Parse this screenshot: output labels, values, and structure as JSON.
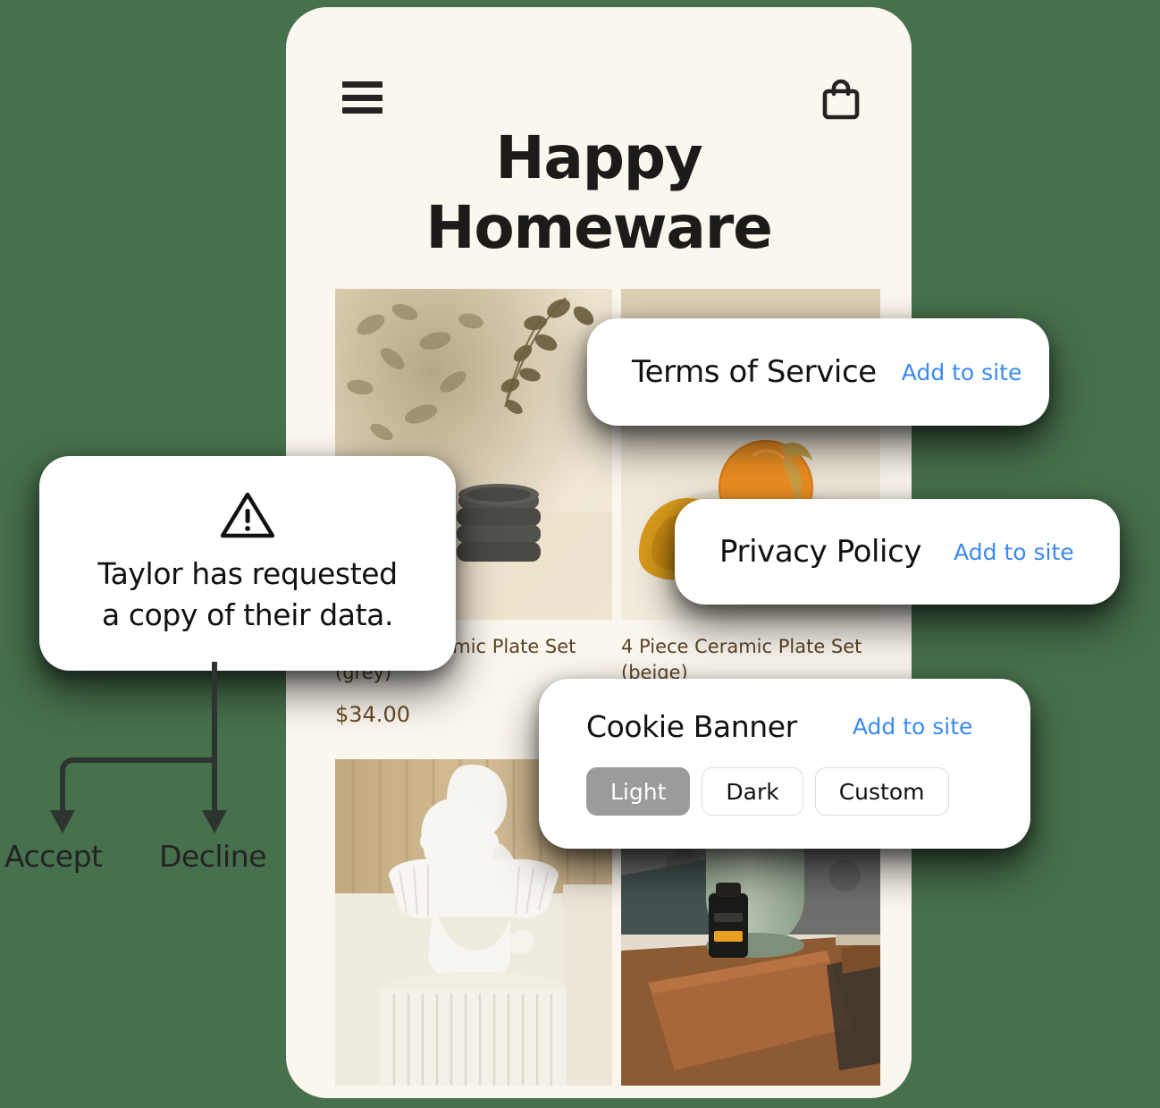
{
  "background_color": "#47704C",
  "phone": {
    "background_color": "#FBF6EE",
    "header": {
      "menu_icon": "hamburger-menu-icon",
      "cart_icon": "shopping-bag-icon",
      "brand_title": "Happy\nHomeware"
    },
    "products": [
      {
        "image": "eucalyptus-shadow-with-dark-stacked-plates",
        "title": "4 Piece Ceramic Plate Set\n(grey)",
        "price": "$34.00"
      },
      {
        "image": "orange-on-plate-with-golden-cloth",
        "title": "4 Piece Ceramic Plate Set\n(beige)",
        "price": ""
      },
      {
        "image": "white-classical-bust-on-fluted-pedestal",
        "title": "",
        "price": ""
      },
      {
        "image": "sage-green-diffuser-with-oil-bottle",
        "title": "",
        "price": ""
      }
    ]
  },
  "cards": {
    "terms_of_service": {
      "title": "Terms of Service",
      "action_label": "Add to site"
    },
    "privacy_policy": {
      "title": "Privacy Policy",
      "action_label": "Add to site"
    },
    "cookie_banner": {
      "title": "Cookie Banner",
      "action_label": "Add to site",
      "themes": [
        {
          "label": "Light",
          "selected": true
        },
        {
          "label": "Dark",
          "selected": false
        },
        {
          "label": "Custom",
          "selected": false
        }
      ]
    },
    "data_request_alert": {
      "icon": "warning-triangle-icon",
      "message": "Taylor has requested\na copy of their data."
    }
  },
  "branch": {
    "accept_label": "Accept",
    "decline_label": "Decline"
  },
  "colors": {
    "accent_blue": "#3B8AF0",
    "selected_gray": "#9B9B9B",
    "product_text": "#5A4326",
    "price_text": "#6B4A22"
  }
}
